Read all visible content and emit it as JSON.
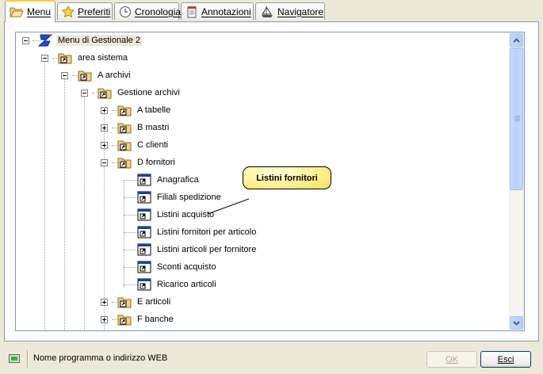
{
  "tabs": [
    {
      "label": "Menu",
      "icon": "folder-open-icon",
      "active": true
    },
    {
      "label": "Preferiti",
      "icon": "star-icon",
      "active": false
    },
    {
      "label": "Cronologia",
      "icon": "clock-icon",
      "active": false
    },
    {
      "label": "Annotazioni",
      "icon": "notepad-icon",
      "active": false
    },
    {
      "label": "Navigatore",
      "icon": "sailboat-icon",
      "active": false
    }
  ],
  "tree": {
    "root": {
      "label": "Menu di Gestionale 2",
      "icon": "app-logo-icon"
    },
    "nodes": [
      {
        "label": "area sistema",
        "type": "folder"
      },
      {
        "label": "A archivi",
        "type": "folder"
      },
      {
        "label": "Gestione archivi",
        "type": "folder"
      },
      {
        "label": "A tabelle",
        "type": "folder"
      },
      {
        "label": "B mastri",
        "type": "folder"
      },
      {
        "label": "C clienti",
        "type": "folder"
      },
      {
        "label": "D fornitori",
        "type": "folder"
      },
      {
        "label": "Anagrafica",
        "type": "program"
      },
      {
        "label": "Filiali spedizione",
        "type": "program"
      },
      {
        "label": "Listini acquisto",
        "type": "program"
      },
      {
        "label": "Listini fornitori per articolo",
        "type": "program"
      },
      {
        "label": "Listini articoli per fornitore",
        "type": "program"
      },
      {
        "label": "Sconti acquisto",
        "type": "program"
      },
      {
        "label": "Ricarico articoli",
        "type": "program"
      },
      {
        "label": "E articoli",
        "type": "folder"
      },
      {
        "label": "F banche",
        "type": "folder"
      }
    ]
  },
  "callout": {
    "text": "Listini fornitori"
  },
  "status": {
    "text": "Nome programma o indirizzo WEB"
  },
  "buttons": {
    "ok_label": "OK",
    "esci_label": "Esci"
  },
  "colors": {
    "accent_tab": "#ffc83c",
    "scrollbar": "#c6d6fc",
    "callout": "#ffef8a"
  }
}
